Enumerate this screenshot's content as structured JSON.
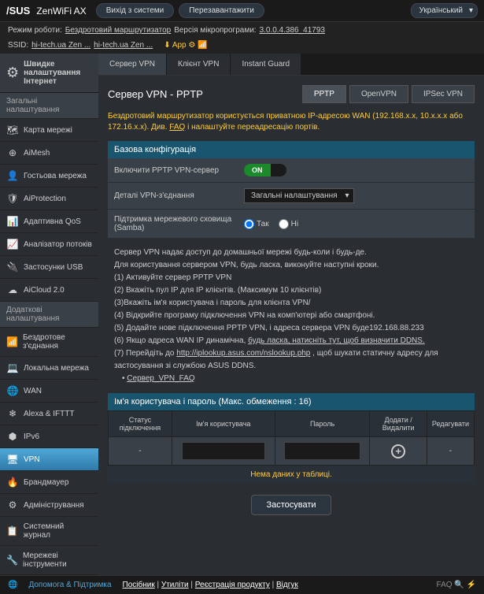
{
  "top": {
    "logo": "/SUS",
    "model": "ZenWiFi AX",
    "logout": "Вихід з системи",
    "reboot": "Перезавантажити",
    "lang": "Український"
  },
  "info": {
    "mode_lbl": "Режим роботи:",
    "mode": "Бездротовий маршрутизатор",
    "fw_lbl": "Версія мікропрограми:",
    "fw": "3.0.0.4.386_41793",
    "ssid_lbl": "SSID:",
    "ssid1": "hi-tech.ua Zen ...",
    "ssid2": "hi-tech.ua Zen ...",
    "app": "App"
  },
  "sidebar": {
    "quick": "Швидке налаштування Інтернет",
    "h1": "Загальні налаштування",
    "g": [
      {
        "i": "🗺",
        "t": "Карта мережі"
      },
      {
        "i": "⊕",
        "t": "AiMesh"
      },
      {
        "i": "👤",
        "t": "Гостьова мережа"
      },
      {
        "i": "🛡",
        "t": "AiProtection"
      },
      {
        "i": "📊",
        "t": "Адаптивна QoS"
      },
      {
        "i": "📈",
        "t": "Аналізатор потоків"
      },
      {
        "i": "🔌",
        "t": "Застосунки USB"
      },
      {
        "i": "☁",
        "t": "AiCloud 2.0"
      }
    ],
    "h2": "Додаткові налаштування",
    "a": [
      {
        "i": "📶",
        "t": "Бездротове з'єднання"
      },
      {
        "i": "💻",
        "t": "Локальна мережа"
      },
      {
        "i": "🌐",
        "t": "WAN"
      },
      {
        "i": "❄",
        "t": "Alexa & IFTTT"
      },
      {
        "i": "⬢",
        "t": "IPv6"
      },
      {
        "i": "🖥",
        "t": "VPN",
        "active": true
      },
      {
        "i": "🔥",
        "t": "Брандмауер"
      },
      {
        "i": "⚙",
        "t": "Адміністрування"
      },
      {
        "i": "📋",
        "t": "Системний журнал"
      },
      {
        "i": "🔧",
        "t": "Мережеві інструменти"
      }
    ]
  },
  "tabs": [
    "Сервер VPN",
    "Клієнт VPN",
    "Instant Guard"
  ],
  "page": {
    "title": "Сервер VPN - PPTP",
    "proto": [
      "PPTP",
      "OpenVPN",
      "IPSec VPN"
    ],
    "desc1": "Бездротовий маршрутизатор користується приватною IP-адресою WAN (192.168.x.x, 10.x.x.x або 172.16.x.x). Див.",
    "faq": "FAQ",
    "desc2": "і налаштуйте переадресацію портів.",
    "sect": "Базова конфігурація",
    "r1": "Включити PPTP VPN-сервер",
    "on": "ON",
    "r2": "Деталі VPN-з'єднання",
    "sel": "Загальні налаштування",
    "r3": "Підтримка мережевого сховища (Samba)",
    "yes": "Так",
    "no": "Ні",
    "n1": "Сервер VPN надає доступ до домашньої мережі будь-коли і будь-де.",
    "n2": "Для користування сервером VPN, будь ласка, виконуйте наступні кроки.",
    "s1": "(1) Активуйте сервер PPTP VPN",
    "s2": "(2) Вкажіть пул IP для IP клієнтів. (Максимум 10 клієнтів)",
    "s3": "(3)Вкажіть ім'я користувача і пароль для клієнта VPN/",
    "s4": "(4) Відкрийте програму підключення VPN на комп'ютері або смартфоні.",
    "s5": "(5) Додайте нове підключення PPTP VPN, і адреса сервера VPN буде192.168.88.233",
    "s6a": "(6) Якщо адреса WAN IP динамічна,",
    "s6b": "будь ласка, натисніть тут, щоб визначити DDNS.",
    "s7a": "(7) Перейдіть до",
    "s7b": "http://iplookup.asus.com/nslookup.php",
    "s7c": ", щоб шукати статичну адресу для застосування зі службою ASUS DDNS.",
    "faqlink": "Сервер_VPN_FAQ",
    "thead": "Ім'я користувача і пароль (Макс. обмеження : 16)",
    "th": [
      "Статус підключення",
      "Ім'я користувача",
      "Пароль",
      "Додати / Видалити",
      "Редагувати"
    ],
    "nodata": "Нема даних у таблиці.",
    "apply": "Застосувати"
  },
  "footer": {
    "help": "Допомога & Підтримка",
    "links": [
      "Посібник",
      "Утиліти",
      "Реєстрація продукту",
      "Відгук"
    ],
    "faq": "FAQ"
  }
}
